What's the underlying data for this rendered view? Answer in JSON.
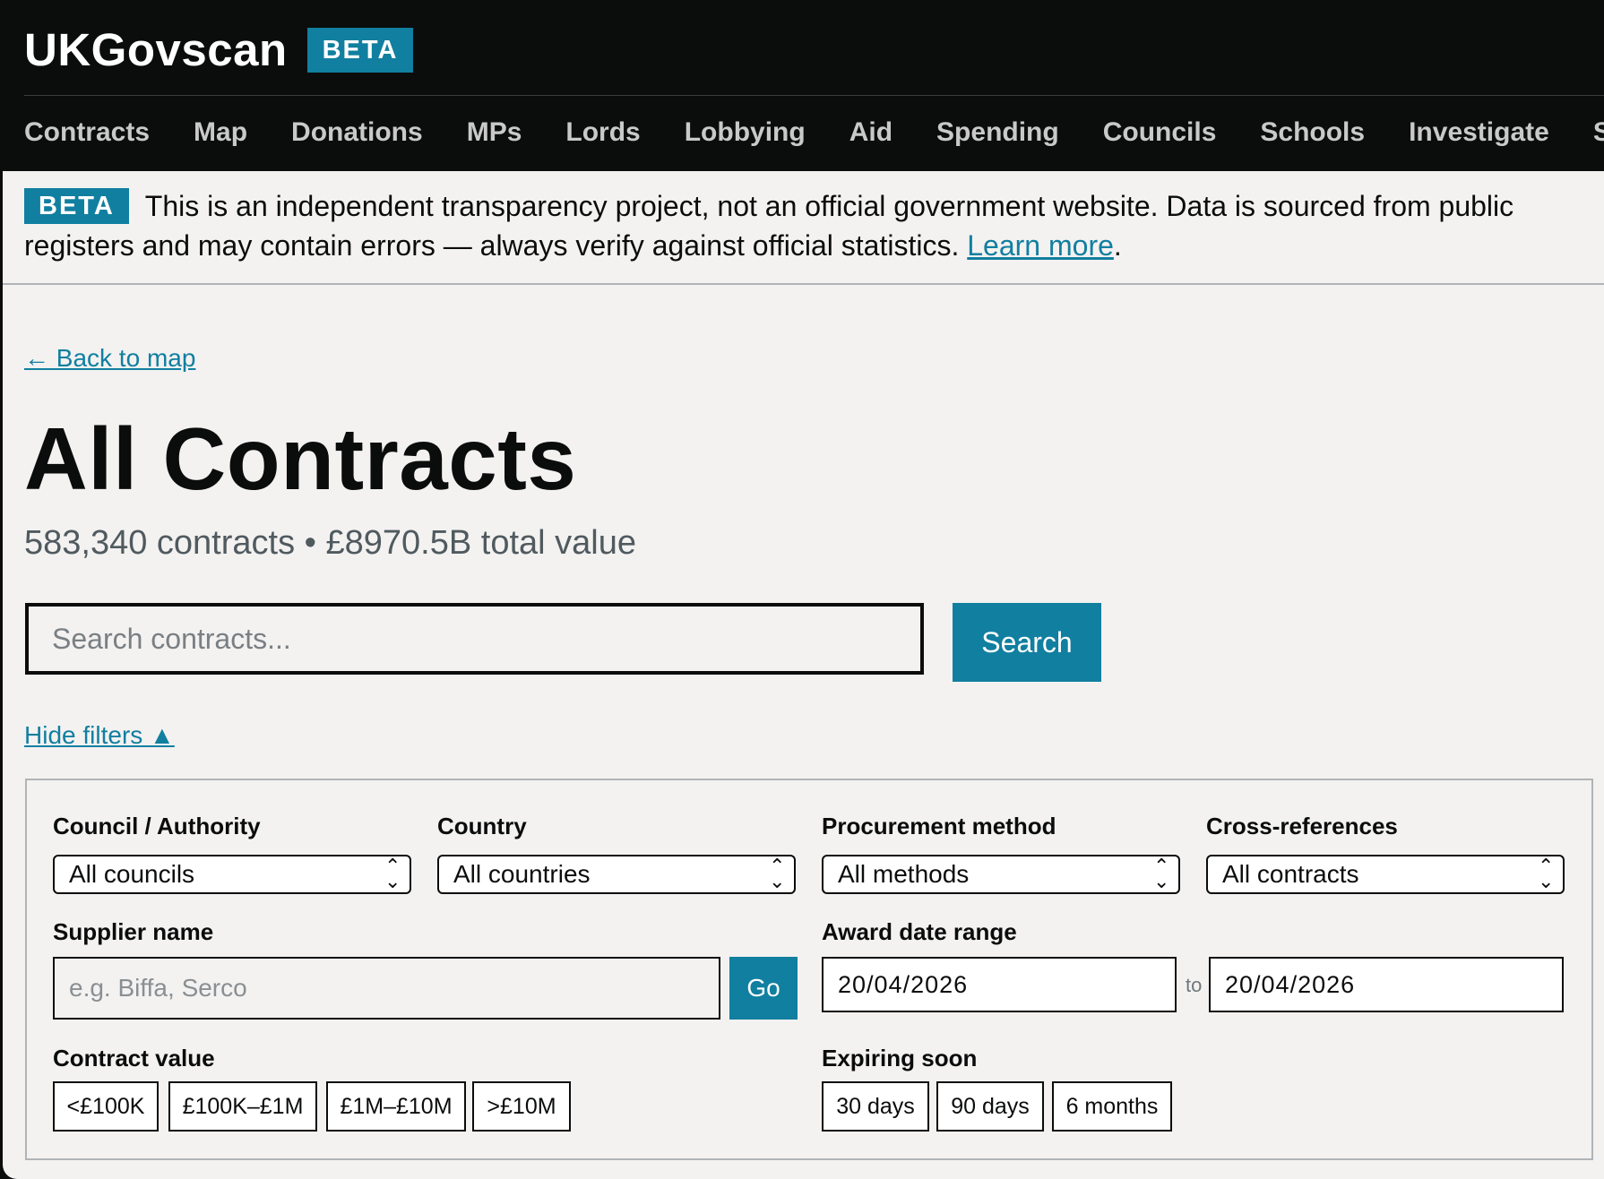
{
  "header": {
    "brand": "UKGovscan",
    "badge": "BETA",
    "nav": [
      "Contracts",
      "Map",
      "Donations",
      "MPs",
      "Lords",
      "Lobbying",
      "Aid",
      "Spending",
      "Councils",
      "Schools",
      "Investigate",
      "Search"
    ]
  },
  "banner": {
    "tag": "BETA",
    "text": "This is an independent transparency project, not an official government website. Data is sourced from public registers and may contain errors — always verify against official statistics. ",
    "link": "Learn more",
    "end": "."
  },
  "back_link": "← Back to map",
  "title": "All Contracts",
  "summary": "583,340 contracts • £8970.5B total value",
  "search": {
    "placeholder": "Search contracts...",
    "button": "Search"
  },
  "filters_toggle": "Hide filters ▲",
  "filters": {
    "council": {
      "label": "Council / Authority",
      "value": "All councils"
    },
    "country": {
      "label": "Country",
      "value": "All countries"
    },
    "procurement": {
      "label": "Procurement method",
      "value": "All methods"
    },
    "crossref": {
      "label": "Cross-references",
      "value": "All contracts"
    },
    "supplier": {
      "label": "Supplier name",
      "placeholder": "e.g. Biffa, Serco",
      "button": "Go"
    },
    "award_date": {
      "label": "Award date range",
      "from": "20/04/2026",
      "to_label": "to",
      "to": "20/04/2026"
    },
    "value": {
      "label": "Contract value",
      "options": [
        "<£100K",
        "£100K–£1M",
        "£1M–£10M",
        ">£10M"
      ]
    },
    "expiring": {
      "label": "Expiring soon",
      "options": [
        "30 days",
        "90 days",
        "6 months"
      ]
    }
  },
  "colors": {
    "accent": "#117fa0",
    "header_bg": "#0b0c0c",
    "page_bg": "#f3f2f1"
  }
}
